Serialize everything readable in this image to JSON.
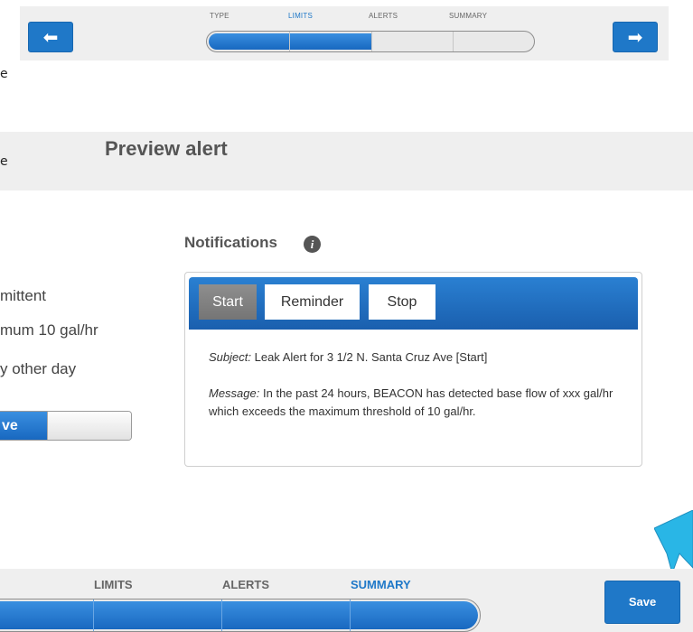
{
  "top_wizard": {
    "prev_icon": "arrow-left-icon",
    "next_icon": "arrow-right-icon",
    "prev_glyph": "⬅",
    "next_glyph": "➡",
    "steps": [
      {
        "label": "TYPE",
        "active": false
      },
      {
        "label": "LIMITS",
        "active": true
      },
      {
        "label": "ALERTS",
        "active": false
      },
      {
        "label": "SUMMARY",
        "active": false
      }
    ],
    "progress_fraction": 0.5
  },
  "stray_texts": [
    "e",
    "e"
  ],
  "preview": {
    "title": "Preview alert"
  },
  "summary_fragments": {
    "type": "mittent",
    "limit": "mum 10 gal/hr",
    "frequency": "y other day",
    "toggle_label": "ve",
    "toggle_on": true
  },
  "notifications": {
    "heading": "Notifications",
    "info_icon": "info-icon",
    "info_glyph": "i",
    "tabs": [
      {
        "label": "Start",
        "active": true
      },
      {
        "label": "Reminder",
        "active": false
      },
      {
        "label": "Stop",
        "active": false
      }
    ],
    "subject_label": "Subject:",
    "subject": "Leak Alert for 3 1/2 N. Santa Cruz Ave [Start]",
    "message_label": "Message:",
    "message": "In the past 24 hours, BEACON has detected base flow of xxx gal/hr which exceeds the maximum threshold of 10 gal/hr."
  },
  "bottom_wizard": {
    "steps": [
      {
        "label": "LIMITS",
        "active": false
      },
      {
        "label": "ALERTS",
        "active": false
      },
      {
        "label": "SUMMARY",
        "active": true
      }
    ],
    "progress_fraction": 1.0,
    "save_label": "Save"
  },
  "colors": {
    "accent": "#1f78c8",
    "bar_background": "#efefef",
    "annotation_arrow": "#29b6e6"
  }
}
